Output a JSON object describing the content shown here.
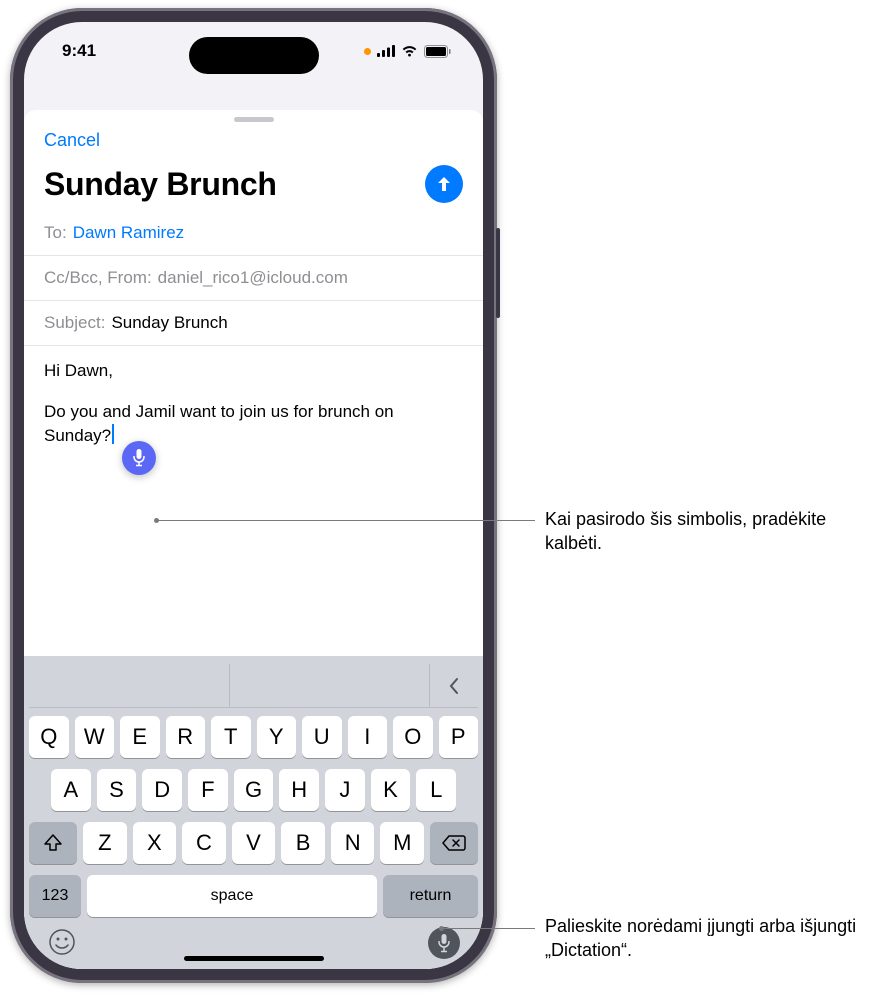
{
  "status": {
    "time": "9:41"
  },
  "sheet": {
    "cancel": "Cancel",
    "title": "Sunday Brunch"
  },
  "fields": {
    "to_label": "To:",
    "to_value": "Dawn Ramirez",
    "ccbcc_label": "Cc/Bcc, From:",
    "ccbcc_value": "daniel_rico1@icloud.com",
    "subject_label": "Subject:",
    "subject_value": "Sunday Brunch"
  },
  "body": {
    "line1": "Hi Dawn,",
    "line2": "Do you and Jamil want to join us for brunch on Sunday?"
  },
  "keyboard": {
    "row1": [
      "Q",
      "W",
      "E",
      "R",
      "T",
      "Y",
      "U",
      "I",
      "O",
      "P"
    ],
    "row2": [
      "A",
      "S",
      "D",
      "F",
      "G",
      "H",
      "J",
      "K",
      "L"
    ],
    "row3": [
      "Z",
      "X",
      "C",
      "V",
      "B",
      "N",
      "M"
    ],
    "num_key": "123",
    "space_key": "space",
    "return_key": "return"
  },
  "callouts": {
    "c1": "Kai pasirodo šis simbolis, pradėkite kalbėti.",
    "c2": "Palieskite norėdami įjungti arba išjungti „Dictation“."
  }
}
